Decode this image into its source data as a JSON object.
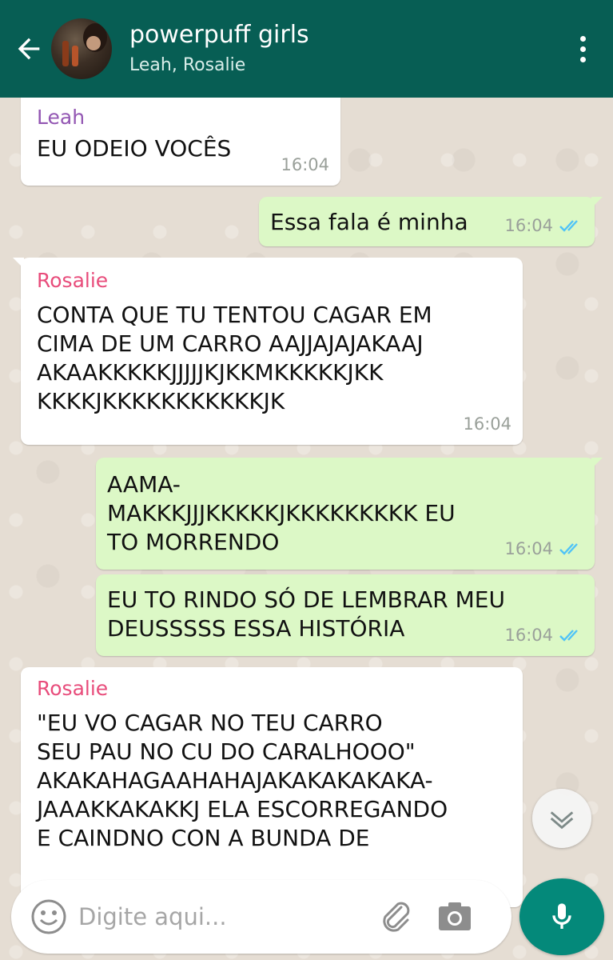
{
  "header": {
    "title": "powerpuff girls",
    "subtitle": "Leah, Rosalie"
  },
  "messages": [
    {
      "direction": "in",
      "sender": "Leah",
      "text": "EU ODEIO VOCÊS",
      "time": "16:04"
    },
    {
      "direction": "out",
      "text": "Essa fala é minha",
      "time": "16:04",
      "status": "read"
    },
    {
      "direction": "in",
      "sender": "Rosalie",
      "text": "CONTA QUE TU TENTOU CAGAR EM\nCIMA DE UM CARRO AAJJAJAJAKAAJ\nAKAAKKKKKJJJJJKJKKMKKKKKJKK\nKKKKJKKKKKKKKKKKJK",
      "time": "16:04"
    },
    {
      "direction": "out",
      "text": "AAMA-\nMAKKKJJJKKKKKJKKKKKKKKK EU\nTO MORRENDO",
      "time": "16:04",
      "status": "read"
    },
    {
      "direction": "out",
      "text": "EU TO RINDO SÓ DE LEMBRAR MEU\nDEUSSSSS ESSA HISTÓRIA",
      "time": "16:04",
      "status": "read"
    },
    {
      "direction": "in",
      "sender": "Rosalie",
      "text": "\"EU VO CAGAR NO TEU CARRO\nSEU PAU NO CU DO CARALHOOO\"\nAKAKAHAGAAHAHAJAKAKAKAKAKA-\nJAAAKKAKAKKJ ELA ESCORREGANDO\nE CAINDNO CON A BUNDA DE",
      "time": ""
    }
  ],
  "input": {
    "placeholder": "Digite aqui..."
  },
  "icons": {
    "back": "arrow-left-icon",
    "menu": "more-vertical-icon",
    "emoji": "emoji-icon",
    "attach": "paperclip-icon",
    "camera": "camera-icon",
    "mic": "microphone-icon",
    "scroll_down": "chevron-down-icon"
  },
  "colors": {
    "header": "#075e54",
    "outgoing_bubble": "#dcf8c6",
    "incoming_bubble": "#ffffff",
    "leah_name": "#9357b3",
    "rosalie_name": "#e84c7b",
    "read_ticks": "#4fc3f7",
    "mic_button": "#04897a"
  }
}
